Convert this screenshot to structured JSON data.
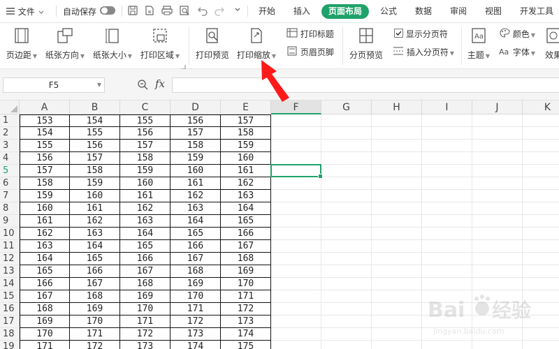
{
  "menubar": {
    "file_label": "文件",
    "autosave_label": "自动保存",
    "tabs": [
      {
        "label": "开始",
        "active": false
      },
      {
        "label": "插入",
        "active": false
      },
      {
        "label": "页面布局",
        "active": true
      },
      {
        "label": "公式",
        "active": false
      },
      {
        "label": "数据",
        "active": false
      },
      {
        "label": "审阅",
        "active": false
      },
      {
        "label": "视图",
        "active": false
      },
      {
        "label": "开发工具",
        "active": false
      }
    ]
  },
  "ribbon": {
    "margins": "页边距",
    "orientation": "纸张方向",
    "size": "纸张大小",
    "print_area": "打印区域",
    "print_preview": "打印预览",
    "print_scale": "打印缩放",
    "print_titles": "打印标题",
    "header_footer": "页眉页脚",
    "page_break_preview": "分页预览",
    "show_page_breaks": "显示分页符",
    "show_page_breaks_checked": true,
    "insert_page_break": "插入分页符",
    "theme": "主题",
    "colors": "颜色",
    "fonts": "字体",
    "effects": "效果"
  },
  "formula_bar": {
    "name_box": "F5",
    "fx": "fx",
    "formula": ""
  },
  "grid": {
    "columns": [
      "A",
      "B",
      "C",
      "D",
      "E",
      "F",
      "G",
      "H",
      "I",
      "J",
      "K"
    ],
    "selected_cell": "F5",
    "rows": [
      {
        "num": "1",
        "values": [
          "153",
          "154",
          "155",
          "156",
          "157"
        ]
      },
      {
        "num": "2",
        "values": [
          "154",
          "155",
          "156",
          "157",
          "158"
        ]
      },
      {
        "num": "3",
        "values": [
          "155",
          "156",
          "157",
          "158",
          "159"
        ]
      },
      {
        "num": "4",
        "values": [
          "156",
          "157",
          "158",
          "159",
          "160"
        ]
      },
      {
        "num": "5",
        "values": [
          "157",
          "158",
          "159",
          "160",
          "161"
        ]
      },
      {
        "num": "6",
        "values": [
          "158",
          "159",
          "160",
          "161",
          "162"
        ]
      },
      {
        "num": "7",
        "values": [
          "159",
          "160",
          "161",
          "162",
          "163"
        ]
      },
      {
        "num": "8",
        "values": [
          "160",
          "161",
          "162",
          "163",
          "164"
        ]
      },
      {
        "num": "9",
        "values": [
          "161",
          "162",
          "163",
          "164",
          "165"
        ]
      },
      {
        "num": "10",
        "values": [
          "162",
          "163",
          "164",
          "165",
          "166"
        ]
      },
      {
        "num": "11",
        "values": [
          "163",
          "164",
          "165",
          "166",
          "167"
        ]
      },
      {
        "num": "12",
        "values": [
          "164",
          "165",
          "166",
          "167",
          "168"
        ]
      },
      {
        "num": "13",
        "values": [
          "165",
          "166",
          "167",
          "168",
          "169"
        ]
      },
      {
        "num": "14",
        "values": [
          "166",
          "167",
          "168",
          "169",
          "170"
        ]
      },
      {
        "num": "15",
        "values": [
          "167",
          "168",
          "169",
          "170",
          "171"
        ]
      },
      {
        "num": "16",
        "values": [
          "168",
          "169",
          "170",
          "171",
          "172"
        ]
      },
      {
        "num": "17",
        "values": [
          "169",
          "170",
          "171",
          "172",
          "173"
        ]
      },
      {
        "num": "18",
        "values": [
          "170",
          "171",
          "172",
          "173",
          "174"
        ]
      },
      {
        "num": "19",
        "values": [
          "171",
          "172",
          "173",
          "174",
          "175"
        ]
      }
    ]
  },
  "colors": {
    "accent": "#1fa26a",
    "arrow": "#ff1a1a"
  },
  "watermark": {
    "brand": "Baidu经验",
    "url": "jingyan.baidu.com"
  }
}
